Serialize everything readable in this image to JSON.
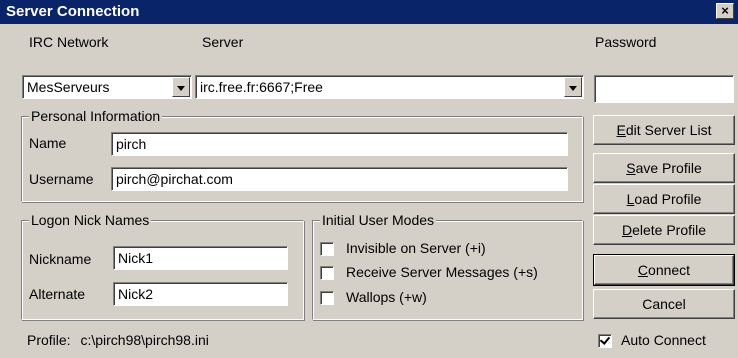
{
  "window": {
    "title": "Server Connection",
    "close_glyph": "×"
  },
  "labels": {
    "irc_network": "IRC Network",
    "server": "Server",
    "password": "Password"
  },
  "network_select": {
    "value": "MesServeurs"
  },
  "server_select": {
    "value": "irc.free.fr:6667;Free"
  },
  "password_field": {
    "value": ""
  },
  "personal": {
    "group_label": "Personal Information",
    "name_label": "Name",
    "name_value": "pirch",
    "username_label": "Username",
    "username_value": "pirch@pirchat.com"
  },
  "nicks": {
    "group_label": "Logon Nick Names",
    "nickname_label": "Nickname",
    "nickname_value": "Nick1",
    "alternate_label": "Alternate",
    "alternate_value": "Nick2"
  },
  "modes": {
    "group_label": "Initial User Modes",
    "options": [
      {
        "label": "Invisible on Server (+i)",
        "checked": false
      },
      {
        "label": "Receive Server Messages (+s)",
        "checked": false
      },
      {
        "label": "Wallops (+w)",
        "checked": false
      }
    ]
  },
  "buttons": {
    "edit_server_list": {
      "accel": "E",
      "rest": "dit Server List"
    },
    "save_profile": {
      "accel": "S",
      "rest": "ave Profile"
    },
    "load_profile": {
      "accel": "L",
      "rest": "oad Profile"
    },
    "delete_profile": {
      "accel": "D",
      "rest": "elete Profile"
    },
    "connect": {
      "accel": "C",
      "rest": "onnect"
    },
    "cancel": "Cancel"
  },
  "footer": {
    "profile_label": "Profile:",
    "profile_path": "c:\\pirch98\\pirch98.ini",
    "auto_connect_label": "Auto Connect",
    "auto_connect_checked": true
  }
}
